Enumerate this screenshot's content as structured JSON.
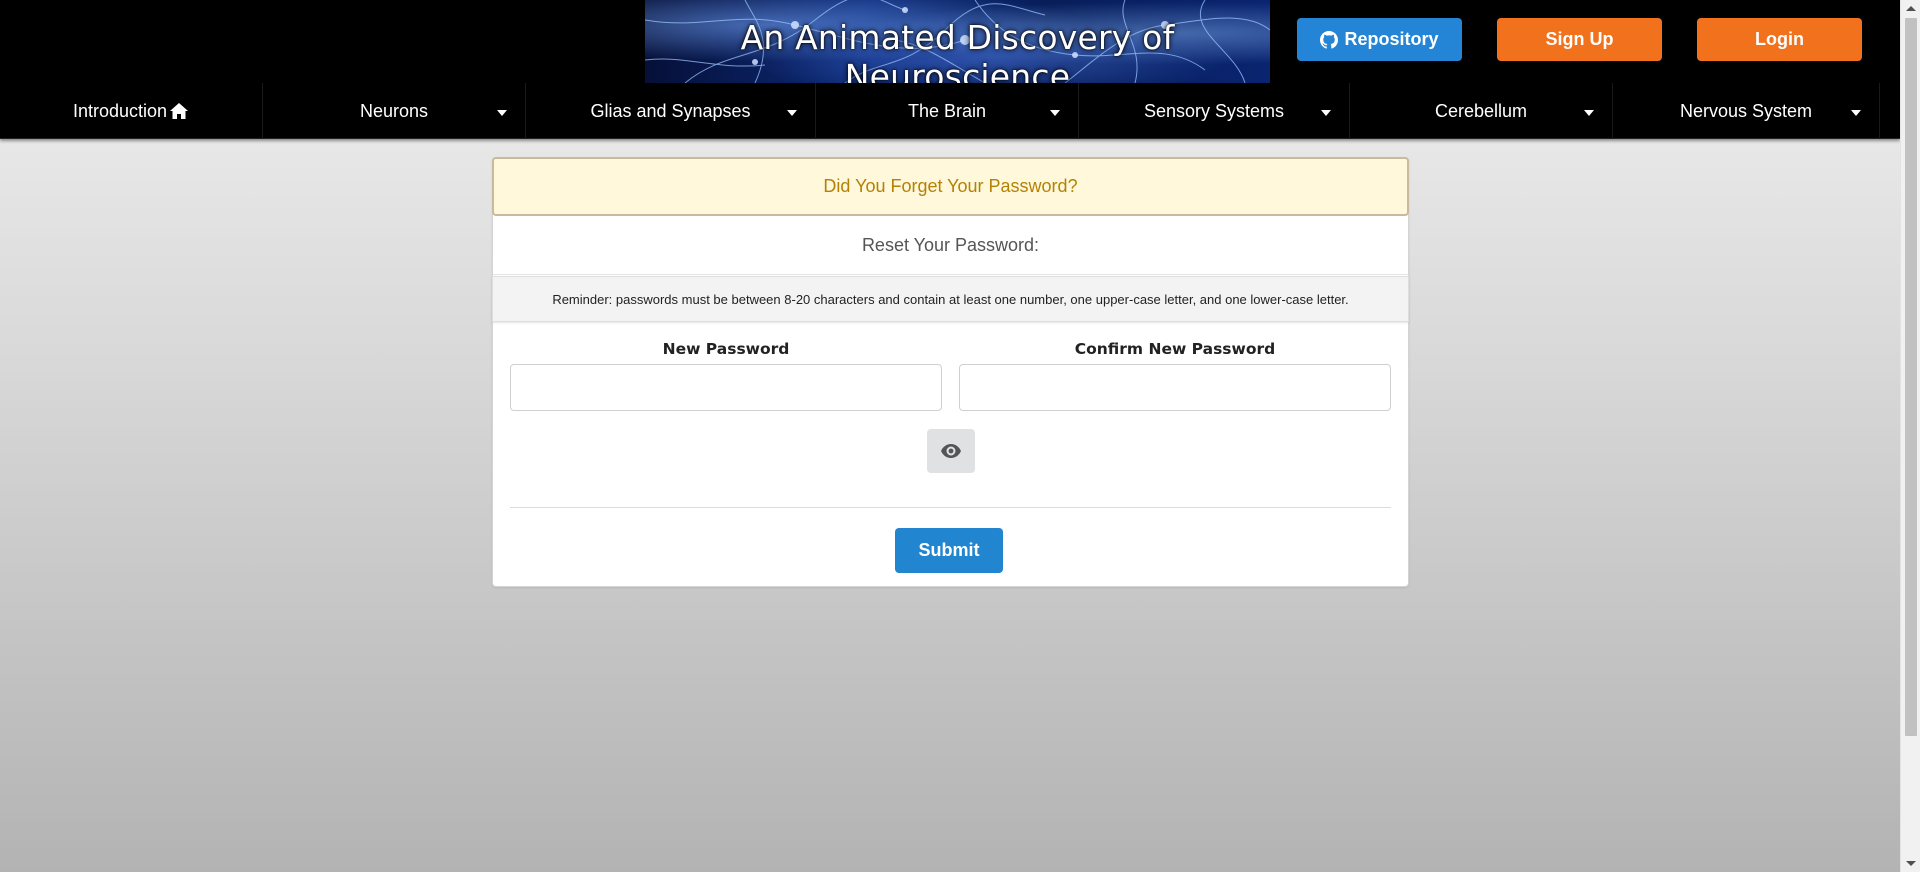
{
  "header": {
    "banner_title": "An Animated Discovery of Neuroscience",
    "buttons": {
      "repository": "Repository",
      "sign_up": "Sign Up",
      "login": "Login"
    },
    "colors": {
      "repository": "#2485d6",
      "sign_up": "#f2711c",
      "login": "#f2711c"
    }
  },
  "nav": {
    "items": [
      {
        "label": "Introduction",
        "icon": "home-icon",
        "dropdown": false
      },
      {
        "label": "Neurons",
        "dropdown": true
      },
      {
        "label": "Glias and Synapses",
        "dropdown": true
      },
      {
        "label": "The Brain",
        "dropdown": true
      },
      {
        "label": "Sensory Systems",
        "dropdown": true
      },
      {
        "label": "Cerebellum",
        "dropdown": true
      },
      {
        "label": "Nervous System",
        "dropdown": true
      }
    ]
  },
  "form": {
    "warning": "Did You Forget Your Password?",
    "title": "Reset Your Password:",
    "reminder": "Reminder: passwords must be between 8-20 characters and contain at least one number, one upper-case letter, and one lower-case letter.",
    "new_password_label": "New Password",
    "new_password_value": "",
    "confirm_password_label": "Confirm New Password",
    "confirm_password_value": "",
    "toggle_icon": "eye-icon",
    "submit_label": "Submit"
  }
}
